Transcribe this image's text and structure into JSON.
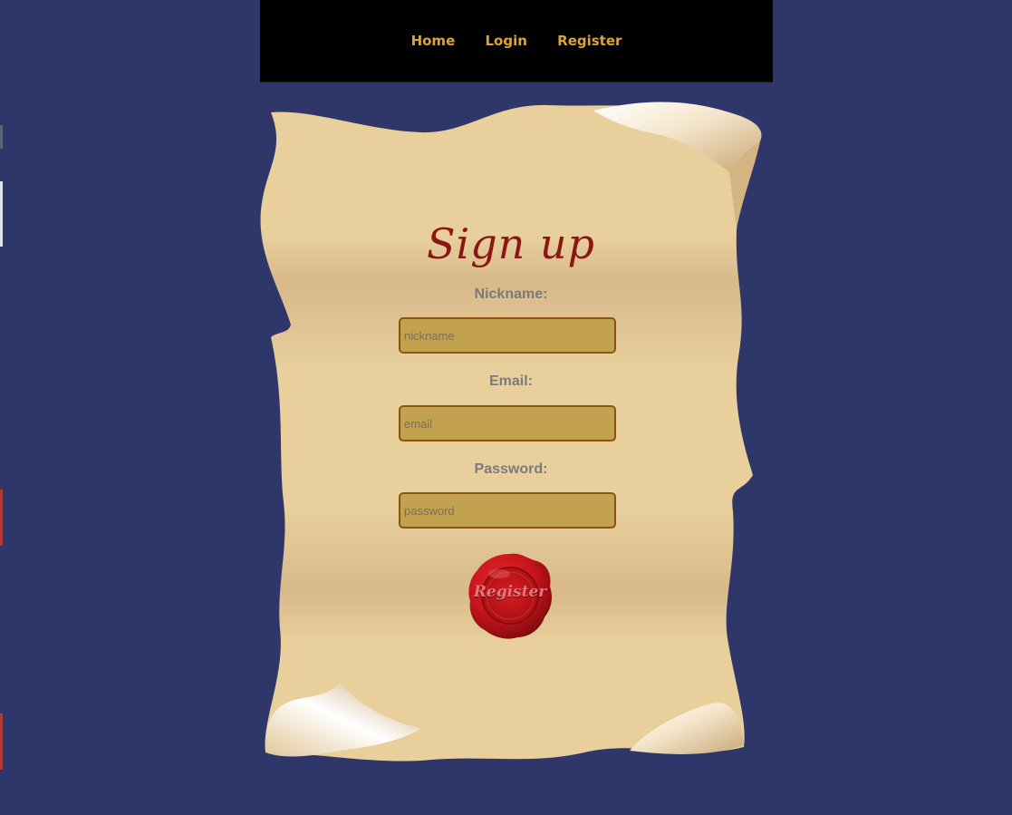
{
  "nav": {
    "links": [
      {
        "label": "Home"
      },
      {
        "label": "Login"
      },
      {
        "label": "Register"
      }
    ]
  },
  "form": {
    "title": "Sign up",
    "fields": [
      {
        "label": "Nickname:",
        "placeholder": "nickname",
        "value": ""
      },
      {
        "label": "Email:",
        "placeholder": "email",
        "value": ""
      },
      {
        "label": "Password:",
        "placeholder": "password",
        "value": ""
      }
    ],
    "submit_label": "Register"
  },
  "colors": {
    "page_background": "#2f376a",
    "nav_background": "#000000",
    "nav_link": "#dba535",
    "title": "#8a1712",
    "label": "#7b7b7b",
    "input_background": "#c3a24f",
    "input_border": "#8a5512",
    "seal": "#c4141a"
  },
  "icons": {
    "seal": "wax-seal-icon",
    "scroll": "parchment-scroll"
  }
}
